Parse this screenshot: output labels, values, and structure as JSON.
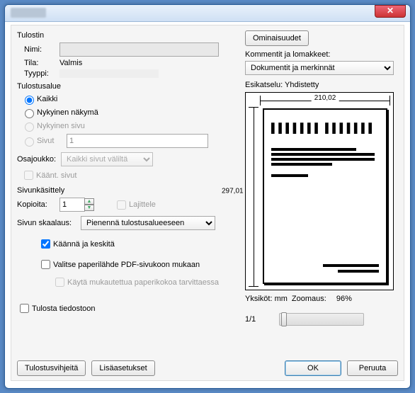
{
  "titlebar": {
    "close_glyph": "✕"
  },
  "printer": {
    "section": "Tulostin",
    "name_label": "Nimi:",
    "name_value": "",
    "properties_btn": "Ominaisuudet",
    "status_label": "Tila:",
    "status_value": "Valmis",
    "type_label": "Tyyppi:",
    "type_value": ""
  },
  "comments": {
    "label": "Kommentit ja lomakkeet:",
    "value": "Dokumentit ja merkinnät"
  },
  "range": {
    "section": "Tulostusalue",
    "all": "Kaikki",
    "current_view": "Nykyinen näkymä",
    "current_page": "Nykyinen sivu",
    "pages": "Sivut",
    "pages_value": "1",
    "subset_label": "Osajoukko:",
    "subset_value": "Kaikki sivut väliltä",
    "reverse": "Käänt. sivut"
  },
  "handling": {
    "section": "Sivunkäsittely",
    "copies_label": "Kopioita:",
    "copies_value": "1",
    "collate": "Lajittele",
    "scaling_label": "Sivun skaalaus:",
    "scaling_value": "Pienennä tulostusalueeseen",
    "rotate_center": "Käännä ja keskitä",
    "paper_source": "Valitse paperilähde PDF-sivukoon mukaan",
    "custom_paper": "Käytä mukautettua paperikokoa tarvittaessa"
  },
  "print_to_file": "Tulosta tiedostoon",
  "preview": {
    "label": "Esikatselu: Yhdistetty",
    "width": "210,02",
    "height": "297,01",
    "units_label": "Yksiköt:",
    "units_value": "mm",
    "zoom_label": "Zoomaus:",
    "zoom_value": "96%",
    "page_indicator": "1/1"
  },
  "buttons": {
    "tips": "Tulostusvihjeitä",
    "advanced": "Lisäasetukset",
    "ok": "OK",
    "cancel": "Peruuta"
  }
}
